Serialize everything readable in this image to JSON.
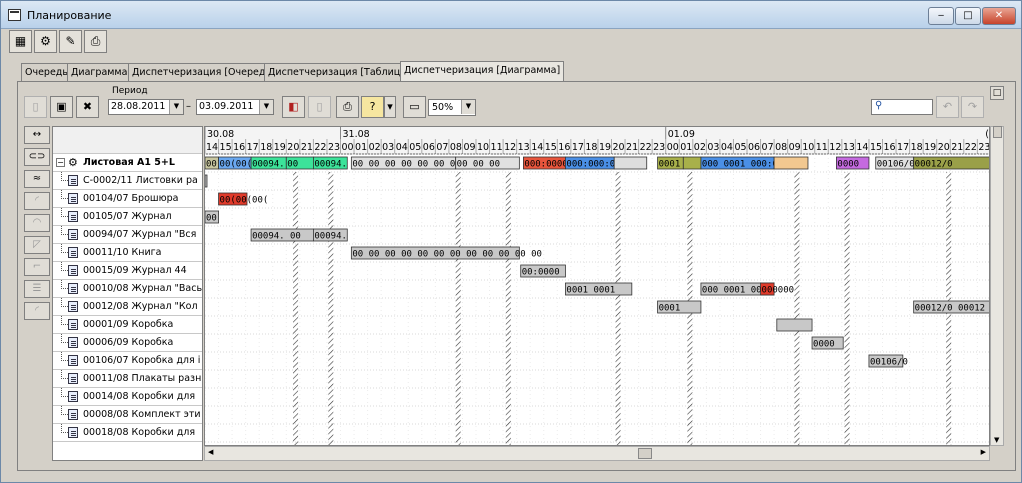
{
  "window": {
    "title": "Планирование"
  },
  "tabs": [
    {
      "label": "Очередь",
      "active": false
    },
    {
      "label": "Диаграмма",
      "active": false
    },
    {
      "label": "Диспетчеризация [Очередь]",
      "active": false
    },
    {
      "label": "Диспетчеризация [Таблица]",
      "active": false
    },
    {
      "label": "Диспетчеризация [Диаграмма]",
      "active": true
    }
  ],
  "period": {
    "label": "Период",
    "from": "28.08.2011",
    "to": "03.09.2011",
    "separator": "–"
  },
  "zoom": {
    "value": "50%"
  },
  "tree": {
    "root": "Листовая А1 5+L",
    "items": [
      "С-0002/11 Листовки ра",
      "00104/07 Брошюра",
      "00105/07 Журнал",
      "00094/07 Журнал \"Вся",
      "00011/10 Книга",
      "00015/09 Журнал 44",
      "00010/08 Журнал \"Вась",
      "00012/08 Журнал \"Кол",
      "00001/09 Коробка",
      "00006/09 Коробка",
      "00106/07 Коробка для і",
      "00011/08 Плакаты разн",
      "00014/08 Коробки для",
      "00008/08 Комплект эти",
      "00018/08 Коробки для"
    ]
  },
  "timeline": {
    "dates": [
      {
        "label": "30.08",
        "start_hour_index": 0
      },
      {
        "label": "31.08",
        "start_hour_index": 10
      },
      {
        "label": "01.09",
        "start_hour_index": 34
      }
    ],
    "hours": [
      "14",
      "15",
      "16",
      "17",
      "18",
      "19",
      "20",
      "21",
      "22",
      "23",
      "00",
      "01",
      "02",
      "03",
      "04",
      "05",
      "06",
      "07",
      "08",
      "09",
      "10",
      "11",
      "12",
      "13",
      "14",
      "15",
      "16",
      "17",
      "18",
      "19",
      "20",
      "21",
      "22",
      "23",
      "00",
      "01",
      "02",
      "03",
      "04",
      "05",
      "06",
      "07",
      "08",
      "09",
      "10",
      "11",
      "12",
      "13",
      "14",
      "15",
      "16",
      "17",
      "18",
      "19",
      "20",
      "21",
      "22",
      "23"
    ],
    "trailing_date": "("
  },
  "summary_row": [
    {
      "text": "001",
      "start": 0,
      "end": 1,
      "color": "#c8c6a0"
    },
    {
      "text": "00(00(00(",
      "start": 1,
      "end": 3.4,
      "color": "#6aa8f0"
    },
    {
      "text": "00094.",
      "start": 3.4,
      "end": 6,
      "color": "#3ce39a"
    },
    {
      "text": "00",
      "start": 6,
      "end": 8,
      "color": "#3ce39a"
    },
    {
      "text": "00094.",
      "start": 8,
      "end": 10.5,
      "color": "#3ce39a"
    },
    {
      "text": "00 00 00 00 00 00 00",
      "start": 10.8,
      "end": 18.5,
      "color": "#e0e0e0"
    },
    {
      "text": "00 00 00",
      "start": 18.5,
      "end": 23.2,
      "color": "#e0e0e0"
    },
    {
      "text": "000:0000",
      "start": 23.5,
      "end": 26.6,
      "color": "#e8553c"
    },
    {
      "text": "000:000:00",
      "start": 26.6,
      "end": 30.2,
      "color": "#4a8fe6"
    },
    {
      "text": "",
      "start": 30.2,
      "end": 32.6,
      "color": "#dedede"
    },
    {
      "text": "0001",
      "start": 33.4,
      "end": 35.3,
      "color": "#a8b04a"
    },
    {
      "text": "",
      "start": 35.3,
      "end": 36.6,
      "color": "#a8b04a"
    },
    {
      "text": "000 0001 000:00",
      "start": 36.6,
      "end": 42,
      "color": "#4a8fe6"
    },
    {
      "text": "",
      "start": 42,
      "end": 44.5,
      "color": "#f2c890"
    },
    {
      "text": "0000",
      "start": 46.6,
      "end": 49,
      "color": "#c56ae0"
    },
    {
      "text": "00106/0",
      "start": 49.5,
      "end": 52.3,
      "color": "#e0e0e0"
    },
    {
      "text": "00012/0",
      "start": 52.3,
      "end": 58,
      "color": "#9aa048"
    }
  ],
  "bars": [
    {
      "row": 1,
      "text": "",
      "start": 0,
      "end": 0.1,
      "color": "#c0c0c0"
    },
    {
      "row": 2,
      "text": "00(00(00(",
      "start": 1,
      "end": 3.1,
      "color": "#e03a2a"
    },
    {
      "row": 3,
      "text": "00",
      "start": 0,
      "end": 1,
      "color": "#c8c8c8"
    },
    {
      "row": 4,
      "text": "00094. 00",
      "start": 3.4,
      "end": 8,
      "color": "#c8c8c8"
    },
    {
      "row": 4,
      "text": "00094.",
      "start": 8,
      "end": 10.5,
      "color": "#c8c8c8"
    },
    {
      "row": 5,
      "text": "00 00 00 00 00 00 00 00 00 00 00 00",
      "start": 10.8,
      "end": 23.2,
      "color": "#c8c8c8"
    },
    {
      "row": 6,
      "text": "00:0000",
      "start": 23.3,
      "end": 26.6,
      "color": "#c8c8c8"
    },
    {
      "row": 7,
      "text": "0001 0001",
      "start": 26.6,
      "end": 31.5,
      "color": "#c8c8c8"
    },
    {
      "row": 7,
      "text": "000 0001 0001 000",
      "start": 36.6,
      "end": 42,
      "color": "#c8c8c8"
    },
    {
      "row": 7,
      "text": "000",
      "start": 41,
      "end": 42,
      "color": "#e03a2a"
    },
    {
      "row": 8,
      "text": "0001",
      "start": 33.4,
      "end": 36.6,
      "color": "#c8c8c8"
    },
    {
      "row": 8,
      "text": "00012/0 00012",
      "start": 52.3,
      "end": 58,
      "color": "#c8c8c8"
    },
    {
      "row": 9,
      "text": "",
      "start": 42.2,
      "end": 44.8,
      "color": "#c8c8c8"
    },
    {
      "row": 10,
      "text": "0000",
      "start": 44.8,
      "end": 47.1,
      "color": "#c8c8c8"
    },
    {
      "row": 11,
      "text": "00106/0",
      "start": 49,
      "end": 51.5,
      "color": "#c8c8c8"
    }
  ],
  "hatch_columns": [
    6.5,
    9.1,
    18.5,
    22.2,
    30.3,
    35.6,
    43.5,
    47.2,
    54.7
  ]
}
